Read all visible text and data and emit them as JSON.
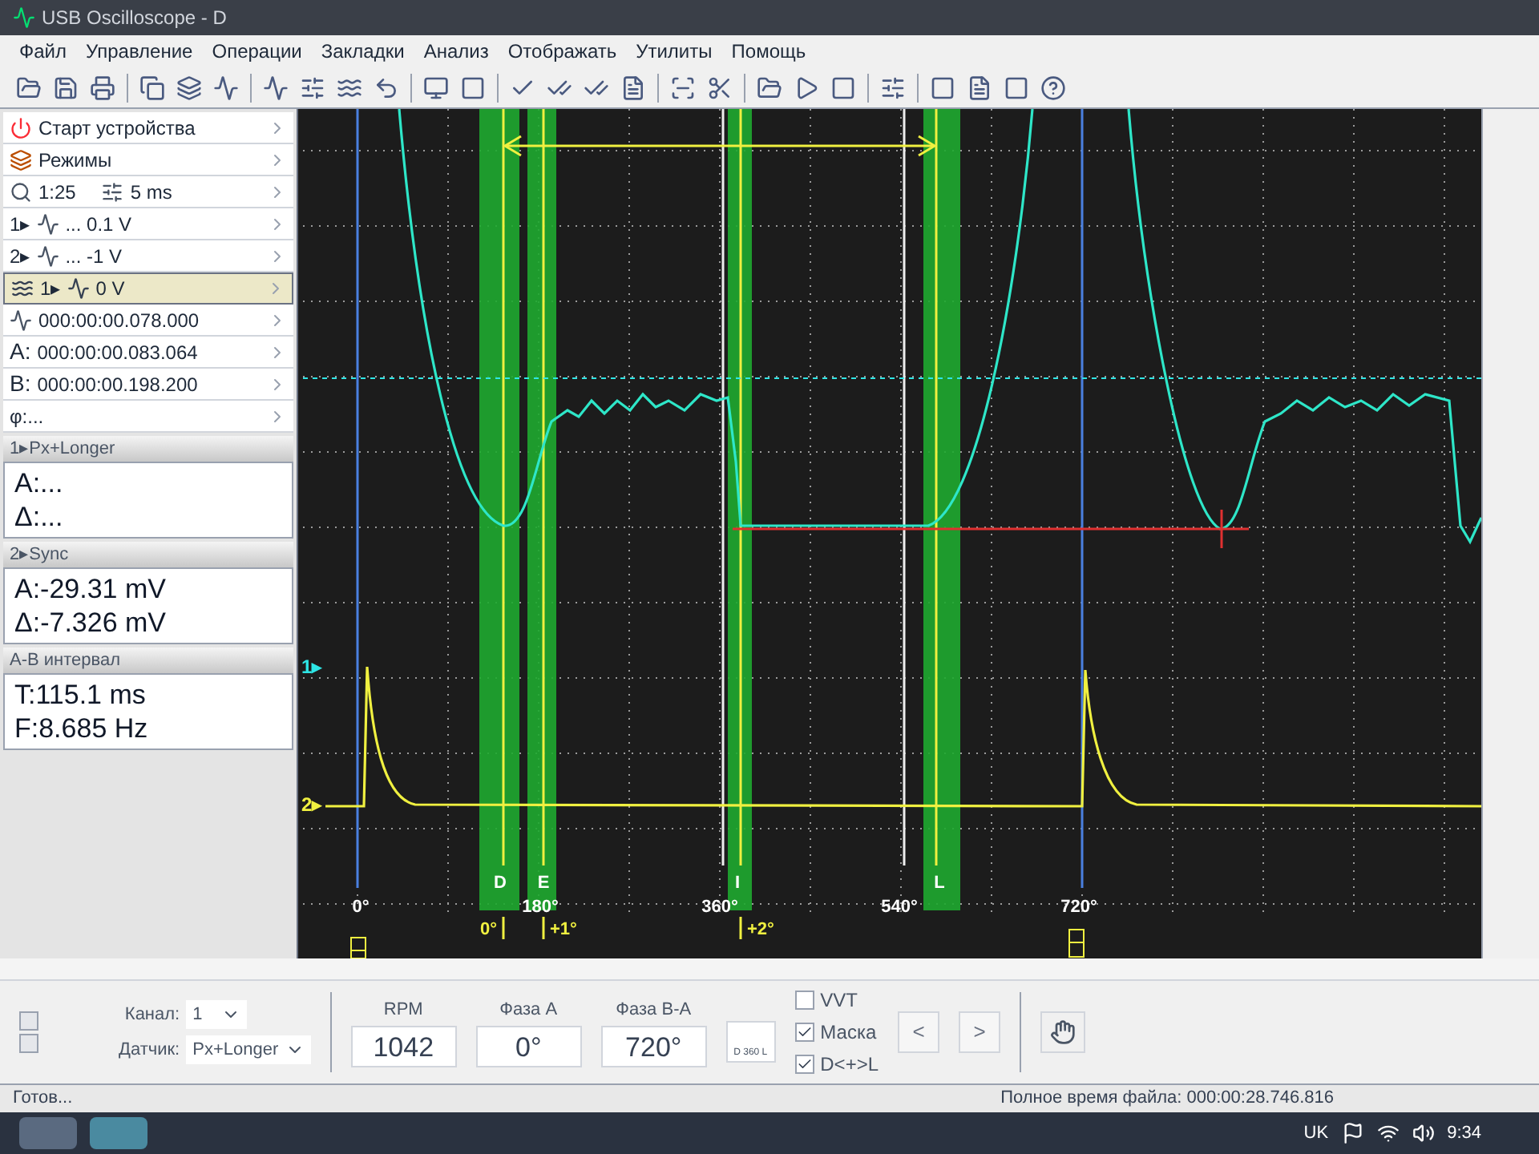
{
  "window": {
    "title": "USB Oscilloscope - D"
  },
  "menu": [
    "Файл",
    "Управление",
    "Операции",
    "Закладки",
    "Анализ",
    "Отображать",
    "Утилиты",
    "Помощь"
  ],
  "left_panel": {
    "controls": [
      {
        "kind": "start",
        "label": "Старт устройства",
        "highlighted": false
      },
      {
        "kind": "modes",
        "label": "Режимы",
        "highlighted": false
      },
      {
        "kind": "scale",
        "zoom": "1:25",
        "timebase": "5 ms",
        "highlighted": false
      },
      {
        "kind": "channel",
        "label": "1▸",
        "value": "... 0.1 V",
        "highlighted": false
      },
      {
        "kind": "channel",
        "label": "2▸",
        "value": "... -1 V",
        "highlighted": false
      },
      {
        "kind": "trigger",
        "label": "1▸",
        "value": "0 V",
        "highlighted": true
      },
      {
        "kind": "time",
        "value": "000:00:00.078.000",
        "highlighted": false
      },
      {
        "kind": "cursor",
        "label": "A:",
        "value": "000:00:00.083.064",
        "highlighted": false
      },
      {
        "kind": "cursor",
        "label": "B:",
        "value": "000:00:00.198.200",
        "highlighted": false
      },
      {
        "kind": "phase",
        "value": "φ:...",
        "highlighted": false
      }
    ],
    "sections": [
      {
        "title": "1▸Px+Longer",
        "lines": [
          "A:...",
          "Δ:..."
        ]
      },
      {
        "title": "2▸Sync",
        "lines": [
          "A:-29.31 mV",
          "Δ:-7.326 mV"
        ]
      },
      {
        "title": "A-B интервал",
        "lines": [
          "T:115.1 ms",
          "F:8.685 Hz"
        ]
      }
    ]
  },
  "scope": {
    "channel_markers": [
      {
        "label": "1▸",
        "color": "#2ee6e6"
      },
      {
        "label": "2▸",
        "color": "#f0f040"
      }
    ],
    "phase_labels": [
      "0°",
      "180°",
      "360°",
      "540°",
      "720°"
    ],
    "band_labels": [
      "D",
      "E",
      "I",
      "L"
    ],
    "offset_labels": [
      "0°",
      "+1°",
      "+2°"
    ]
  },
  "bottom_panel": {
    "channel": {
      "label": "Канал:",
      "value": "1"
    },
    "sensor": {
      "label": "Датчик:",
      "value": "Px+Longer"
    },
    "readouts": [
      {
        "label": "RPM",
        "value": "1042"
      },
      {
        "label": "Фаза A",
        "value": "0°"
      },
      {
        "label": "Фаза B-A",
        "value": "720°"
      }
    ],
    "scale_button": "D 360 L",
    "checkboxes": [
      {
        "label": "VVT",
        "checked": false
      },
      {
        "label": "Маска",
        "checked": true
      },
      {
        "label": "D<+>L",
        "checked": true
      }
    ],
    "nav_buttons": [
      "<",
      ">"
    ]
  },
  "status_bar": {
    "left": "Готов...",
    "right": "Полное время файла: 000:00:28.746.816"
  },
  "taskbar": {
    "language": "UK",
    "time": "9:34"
  }
}
